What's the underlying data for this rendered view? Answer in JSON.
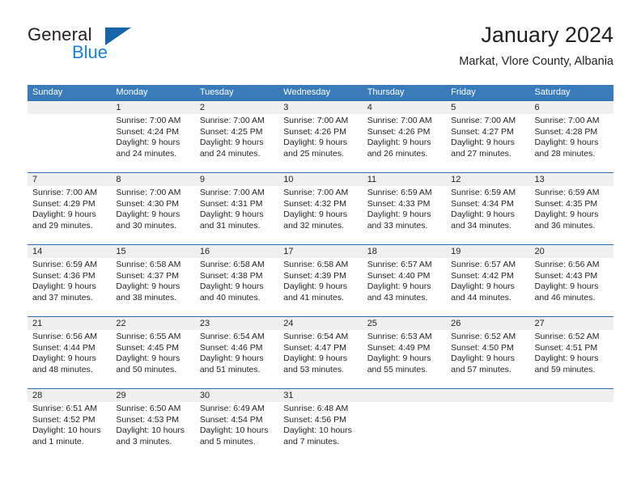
{
  "brand": {
    "name_dark": "General",
    "name_blue": "Blue",
    "accent_blue": "#1d7fd0",
    "triangle_blue": "#1565a8"
  },
  "header": {
    "title": "January 2024",
    "subtitle": "Markat, Vlore County, Albania"
  },
  "theme": {
    "header_row_bg": "#3a7cba",
    "week_divider": "#2f6fab",
    "daynum_band_bg": "#efefef",
    "text": "#231f20"
  },
  "weekdays": [
    "Sunday",
    "Monday",
    "Tuesday",
    "Wednesday",
    "Thursday",
    "Friday",
    "Saturday"
  ],
  "weeks": [
    {
      "days": [
        {
          "num": "",
          "sunrise": "",
          "sunset": "",
          "daylight1": "",
          "daylight2": ""
        },
        {
          "num": "1",
          "sunrise": "Sunrise: 7:00 AM",
          "sunset": "Sunset: 4:24 PM",
          "daylight1": "Daylight: 9 hours",
          "daylight2": "and 24 minutes."
        },
        {
          "num": "2",
          "sunrise": "Sunrise: 7:00 AM",
          "sunset": "Sunset: 4:25 PM",
          "daylight1": "Daylight: 9 hours",
          "daylight2": "and 24 minutes."
        },
        {
          "num": "3",
          "sunrise": "Sunrise: 7:00 AM",
          "sunset": "Sunset: 4:26 PM",
          "daylight1": "Daylight: 9 hours",
          "daylight2": "and 25 minutes."
        },
        {
          "num": "4",
          "sunrise": "Sunrise: 7:00 AM",
          "sunset": "Sunset: 4:26 PM",
          "daylight1": "Daylight: 9 hours",
          "daylight2": "and 26 minutes."
        },
        {
          "num": "5",
          "sunrise": "Sunrise: 7:00 AM",
          "sunset": "Sunset: 4:27 PM",
          "daylight1": "Daylight: 9 hours",
          "daylight2": "and 27 minutes."
        },
        {
          "num": "6",
          "sunrise": "Sunrise: 7:00 AM",
          "sunset": "Sunset: 4:28 PM",
          "daylight1": "Daylight: 9 hours",
          "daylight2": "and 28 minutes."
        }
      ]
    },
    {
      "days": [
        {
          "num": "7",
          "sunrise": "Sunrise: 7:00 AM",
          "sunset": "Sunset: 4:29 PM",
          "daylight1": "Daylight: 9 hours",
          "daylight2": "and 29 minutes."
        },
        {
          "num": "8",
          "sunrise": "Sunrise: 7:00 AM",
          "sunset": "Sunset: 4:30 PM",
          "daylight1": "Daylight: 9 hours",
          "daylight2": "and 30 minutes."
        },
        {
          "num": "9",
          "sunrise": "Sunrise: 7:00 AM",
          "sunset": "Sunset: 4:31 PM",
          "daylight1": "Daylight: 9 hours",
          "daylight2": "and 31 minutes."
        },
        {
          "num": "10",
          "sunrise": "Sunrise: 7:00 AM",
          "sunset": "Sunset: 4:32 PM",
          "daylight1": "Daylight: 9 hours",
          "daylight2": "and 32 minutes."
        },
        {
          "num": "11",
          "sunrise": "Sunrise: 6:59 AM",
          "sunset": "Sunset: 4:33 PM",
          "daylight1": "Daylight: 9 hours",
          "daylight2": "and 33 minutes."
        },
        {
          "num": "12",
          "sunrise": "Sunrise: 6:59 AM",
          "sunset": "Sunset: 4:34 PM",
          "daylight1": "Daylight: 9 hours",
          "daylight2": "and 34 minutes."
        },
        {
          "num": "13",
          "sunrise": "Sunrise: 6:59 AM",
          "sunset": "Sunset: 4:35 PM",
          "daylight1": "Daylight: 9 hours",
          "daylight2": "and 36 minutes."
        }
      ]
    },
    {
      "days": [
        {
          "num": "14",
          "sunrise": "Sunrise: 6:59 AM",
          "sunset": "Sunset: 4:36 PM",
          "daylight1": "Daylight: 9 hours",
          "daylight2": "and 37 minutes."
        },
        {
          "num": "15",
          "sunrise": "Sunrise: 6:58 AM",
          "sunset": "Sunset: 4:37 PM",
          "daylight1": "Daylight: 9 hours",
          "daylight2": "and 38 minutes."
        },
        {
          "num": "16",
          "sunrise": "Sunrise: 6:58 AM",
          "sunset": "Sunset: 4:38 PM",
          "daylight1": "Daylight: 9 hours",
          "daylight2": "and 40 minutes."
        },
        {
          "num": "17",
          "sunrise": "Sunrise: 6:58 AM",
          "sunset": "Sunset: 4:39 PM",
          "daylight1": "Daylight: 9 hours",
          "daylight2": "and 41 minutes."
        },
        {
          "num": "18",
          "sunrise": "Sunrise: 6:57 AM",
          "sunset": "Sunset: 4:40 PM",
          "daylight1": "Daylight: 9 hours",
          "daylight2": "and 43 minutes."
        },
        {
          "num": "19",
          "sunrise": "Sunrise: 6:57 AM",
          "sunset": "Sunset: 4:42 PM",
          "daylight1": "Daylight: 9 hours",
          "daylight2": "and 44 minutes."
        },
        {
          "num": "20",
          "sunrise": "Sunrise: 6:56 AM",
          "sunset": "Sunset: 4:43 PM",
          "daylight1": "Daylight: 9 hours",
          "daylight2": "and 46 minutes."
        }
      ]
    },
    {
      "days": [
        {
          "num": "21",
          "sunrise": "Sunrise: 6:56 AM",
          "sunset": "Sunset: 4:44 PM",
          "daylight1": "Daylight: 9 hours",
          "daylight2": "and 48 minutes."
        },
        {
          "num": "22",
          "sunrise": "Sunrise: 6:55 AM",
          "sunset": "Sunset: 4:45 PM",
          "daylight1": "Daylight: 9 hours",
          "daylight2": "and 50 minutes."
        },
        {
          "num": "23",
          "sunrise": "Sunrise: 6:54 AM",
          "sunset": "Sunset: 4:46 PM",
          "daylight1": "Daylight: 9 hours",
          "daylight2": "and 51 minutes."
        },
        {
          "num": "24",
          "sunrise": "Sunrise: 6:54 AM",
          "sunset": "Sunset: 4:47 PM",
          "daylight1": "Daylight: 9 hours",
          "daylight2": "and 53 minutes."
        },
        {
          "num": "25",
          "sunrise": "Sunrise: 6:53 AM",
          "sunset": "Sunset: 4:49 PM",
          "daylight1": "Daylight: 9 hours",
          "daylight2": "and 55 minutes."
        },
        {
          "num": "26",
          "sunrise": "Sunrise: 6:52 AM",
          "sunset": "Sunset: 4:50 PM",
          "daylight1": "Daylight: 9 hours",
          "daylight2": "and 57 minutes."
        },
        {
          "num": "27",
          "sunrise": "Sunrise: 6:52 AM",
          "sunset": "Sunset: 4:51 PM",
          "daylight1": "Daylight: 9 hours",
          "daylight2": "and 59 minutes."
        }
      ]
    },
    {
      "days": [
        {
          "num": "28",
          "sunrise": "Sunrise: 6:51 AM",
          "sunset": "Sunset: 4:52 PM",
          "daylight1": "Daylight: 10 hours",
          "daylight2": "and 1 minute."
        },
        {
          "num": "29",
          "sunrise": "Sunrise: 6:50 AM",
          "sunset": "Sunset: 4:53 PM",
          "daylight1": "Daylight: 10 hours",
          "daylight2": "and 3 minutes."
        },
        {
          "num": "30",
          "sunrise": "Sunrise: 6:49 AM",
          "sunset": "Sunset: 4:54 PM",
          "daylight1": "Daylight: 10 hours",
          "daylight2": "and 5 minutes."
        },
        {
          "num": "31",
          "sunrise": "Sunrise: 6:48 AM",
          "sunset": "Sunset: 4:56 PM",
          "daylight1": "Daylight: 10 hours",
          "daylight2": "and 7 minutes."
        },
        {
          "num": "",
          "sunrise": "",
          "sunset": "",
          "daylight1": "",
          "daylight2": ""
        },
        {
          "num": "",
          "sunrise": "",
          "sunset": "",
          "daylight1": "",
          "daylight2": ""
        },
        {
          "num": "",
          "sunrise": "",
          "sunset": "",
          "daylight1": "",
          "daylight2": ""
        }
      ]
    }
  ]
}
